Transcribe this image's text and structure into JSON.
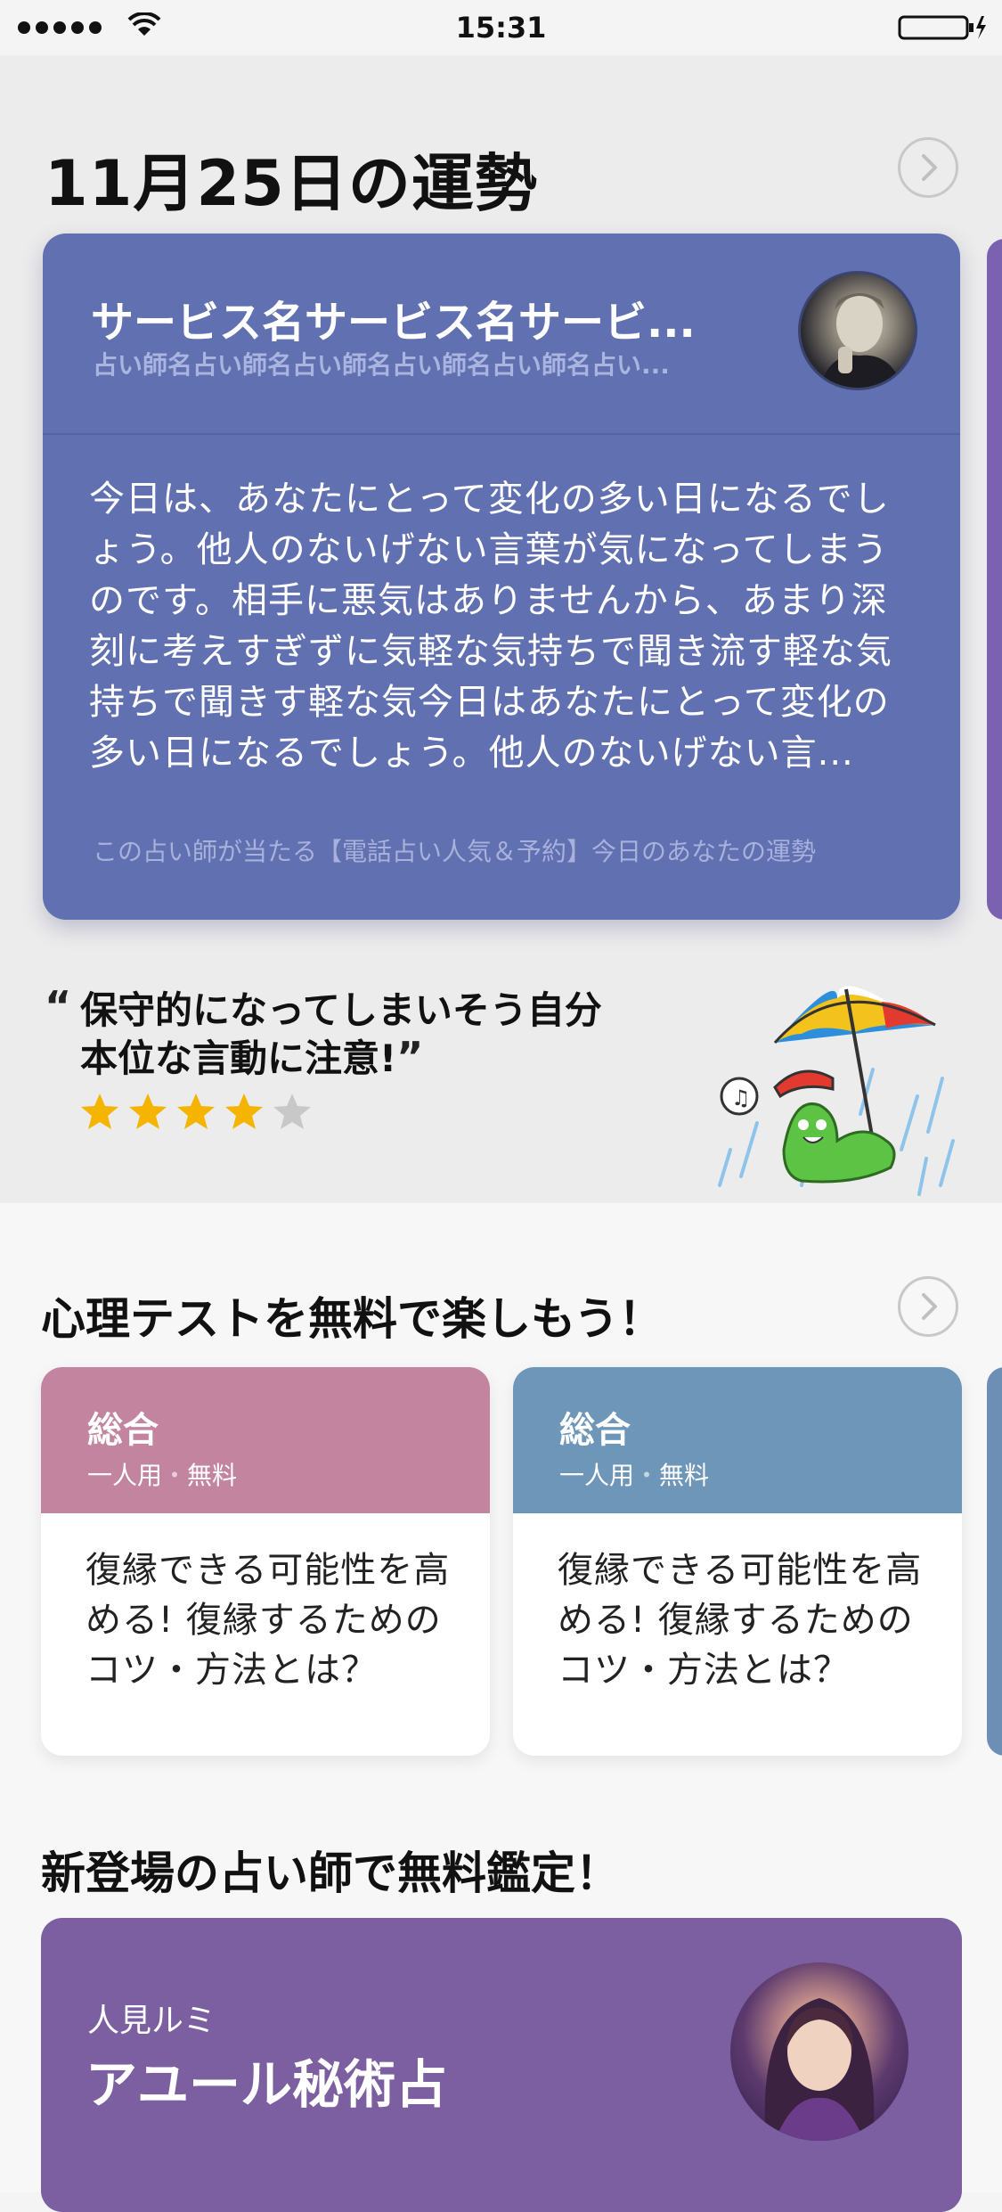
{
  "status_bar": {
    "time": "15:31"
  },
  "fortune": {
    "heading": "11月25日の運勢",
    "card": {
      "service_name": "サービス名サービス名サービ...",
      "teller_names": "占い師名占い師名占い師名占い師名占い師名占い...",
      "body": "今日は、あなたにとって変化の多い日になるでしょう。他人のないげない言葉が気になってしまうのです。相手に悪気はありませんから、あまり深刻に考えすぎずに気軽な気持ちで聞き流す軽な気持ちで聞きす軽な気今日はあなたにとって変化の多い日になるでしょう。他人のないげない言...",
      "footer": "この占い師が当たる【電話占い人気＆予約】今日のあなたの運勢"
    },
    "quote": {
      "open_mark": "“",
      "text": "保守的になってしまいそう自分本位な言動に注意!",
      "close_mark": "”",
      "rating": 4,
      "rating_max": 5
    }
  },
  "psych_tests": {
    "heading": "心理テストを無料で楽しもう！",
    "items": [
      {
        "category": "総合",
        "meta_1": "一人用",
        "meta_sep": "・",
        "meta_2": "無料",
        "title": "復縁できる可能性を高める! 復縁するためのコツ・方法とは？",
        "color": "#c2849f"
      },
      {
        "category": "総合",
        "meta_1": "一人用",
        "meta_sep": "・",
        "meta_2": "無料",
        "title": "復縁できる可能性を高める! 復縁するためのコツ・方法とは？",
        "color": "#6d96b8"
      }
    ]
  },
  "new_tellers": {
    "heading": "新登場の占い師で無料鑑定！",
    "card": {
      "teller_name": "人見ルミ",
      "service": "アユール秘術占",
      "color": "#7b5fa0"
    }
  },
  "colors": {
    "fortune_card": "#6070b0",
    "star_on": "#f5b400",
    "star_off": "#c8c8c8"
  }
}
